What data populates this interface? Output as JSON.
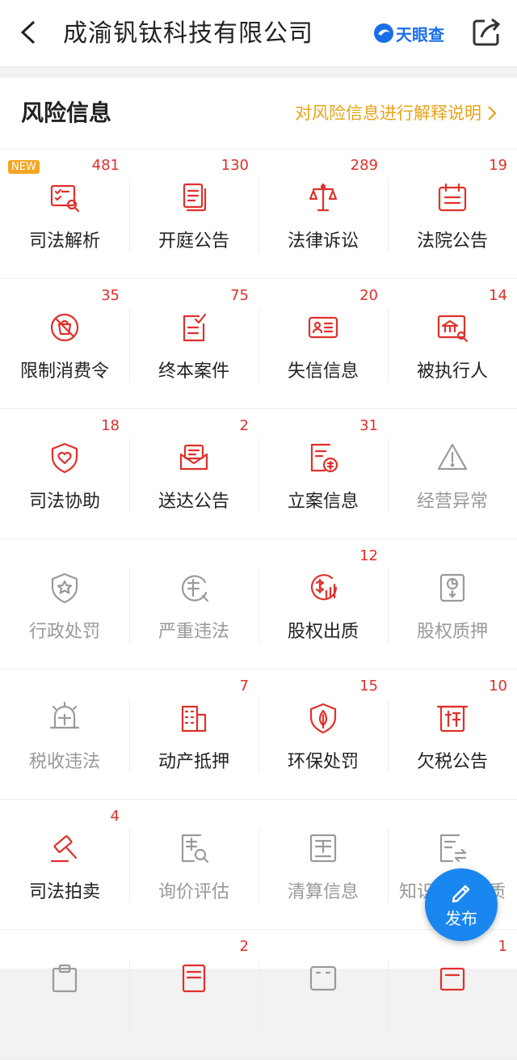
{
  "header": {
    "title": "成渝钒钛科技有限公司",
    "brand": "天眼查",
    "brand_color": "#1a6fe8",
    "back_icon": "chevron-left-icon",
    "share_icon": "share-icon"
  },
  "section": {
    "title": "风险信息",
    "link": "对风险信息进行解释说明",
    "link_color": "#e8a317"
  },
  "new_badge": "NEW",
  "rows": [
    [
      {
        "label": "司法解析",
        "count": "481",
        "icon": "judicial-analysis-icon",
        "active": true,
        "new": true
      },
      {
        "label": "开庭公告",
        "count": "130",
        "icon": "document-icon",
        "active": true
      },
      {
        "label": "法律诉讼",
        "count": "289",
        "icon": "scales-icon",
        "active": true
      },
      {
        "label": "法院公告",
        "count": "19",
        "icon": "calendar-icon",
        "active": true
      }
    ],
    [
      {
        "label": "限制消费令",
        "count": "35",
        "icon": "no-shopping-icon",
        "active": true
      },
      {
        "label": "终本案件",
        "count": "75",
        "icon": "checklist-icon",
        "active": true
      },
      {
        "label": "失信信息",
        "count": "20",
        "icon": "id-card-icon",
        "active": true
      },
      {
        "label": "被执行人",
        "count": "14",
        "icon": "building-search-icon",
        "active": true
      }
    ],
    [
      {
        "label": "司法协助",
        "count": "18",
        "icon": "shield-heart-icon",
        "active": true
      },
      {
        "label": "送达公告",
        "count": "2",
        "icon": "envelope-icon",
        "active": true
      },
      {
        "label": "立案信息",
        "count": "31",
        "icon": "case-file-icon",
        "active": true
      },
      {
        "label": "经营异常",
        "count": "",
        "icon": "warning-icon",
        "active": false
      }
    ],
    [
      {
        "label": "行政处罚",
        "count": "",
        "icon": "shield-star-icon",
        "active": false
      },
      {
        "label": "严重违法",
        "count": "",
        "icon": "violation-icon",
        "active": false
      },
      {
        "label": "股权出质",
        "count": "12",
        "icon": "equity-pledge-icon",
        "active": true
      },
      {
        "label": "股权质押",
        "count": "",
        "icon": "pie-doc-icon",
        "active": false
      }
    ],
    [
      {
        "label": "税收违法",
        "count": "",
        "icon": "tax-alarm-icon",
        "active": false
      },
      {
        "label": "动产抵押",
        "count": "7",
        "icon": "buildings-icon",
        "active": true
      },
      {
        "label": "环保处罚",
        "count": "15",
        "icon": "leaf-shield-icon",
        "active": true
      },
      {
        "label": "欠税公告",
        "count": "10",
        "icon": "tax-icon",
        "active": true
      }
    ],
    [
      {
        "label": "司法拍卖",
        "count": "4",
        "icon": "gavel-icon",
        "active": true
      },
      {
        "label": "询价评估",
        "count": "",
        "icon": "price-search-icon",
        "active": false
      },
      {
        "label": "清算信息",
        "count": "",
        "icon": "ledger-icon",
        "active": false
      },
      {
        "label": "知识产权出质",
        "count": "",
        "icon": "ip-pledge-icon",
        "active": false
      }
    ],
    [
      {
        "label": "",
        "count": "",
        "icon": "clipboard-icon",
        "active": false
      },
      {
        "label": "",
        "count": "2",
        "icon": "doc-icon",
        "active": true
      },
      {
        "label": "",
        "count": "",
        "icon": "grid-icon",
        "active": false
      },
      {
        "label": "",
        "count": "1",
        "icon": "card-icon",
        "active": true
      }
    ]
  ],
  "fab": {
    "label": "发布",
    "icon": "pencil-icon",
    "color": "#1a86f0"
  },
  "colors": {
    "active": "#e0302a",
    "inactive": "#9a9a9a",
    "count": "#e0302a"
  }
}
